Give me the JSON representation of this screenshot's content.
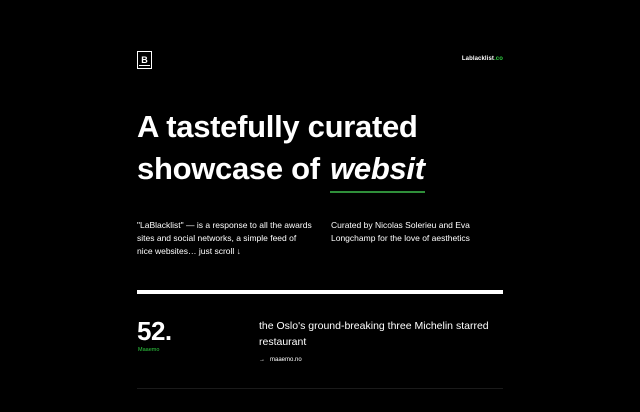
{
  "header": {
    "logo_letter": "B",
    "site_name": "Lablacklist",
    "site_tld": ".co"
  },
  "hero": {
    "line1": "A tastefully curated",
    "line2_prefix": "showcase of ",
    "line2_typed": "websit"
  },
  "intro": {
    "left": "\"LaBlacklist\" — is a response to all the awards sites and social networks, a simple feed of nice websites… just scroll ↓",
    "right": "Curated by Nicolas Solerieu and Eva Longchamp for the love of aesthetics"
  },
  "entry": {
    "number": "52.",
    "site_name": "Maaemo",
    "description": "the Oslo's ground-breaking three Michelin starred restaurant",
    "link_arrow": "→",
    "link_text": "maaemo.no"
  },
  "colors": {
    "background": "#000000",
    "text": "#ffffff",
    "accent": "#2ecc40"
  }
}
